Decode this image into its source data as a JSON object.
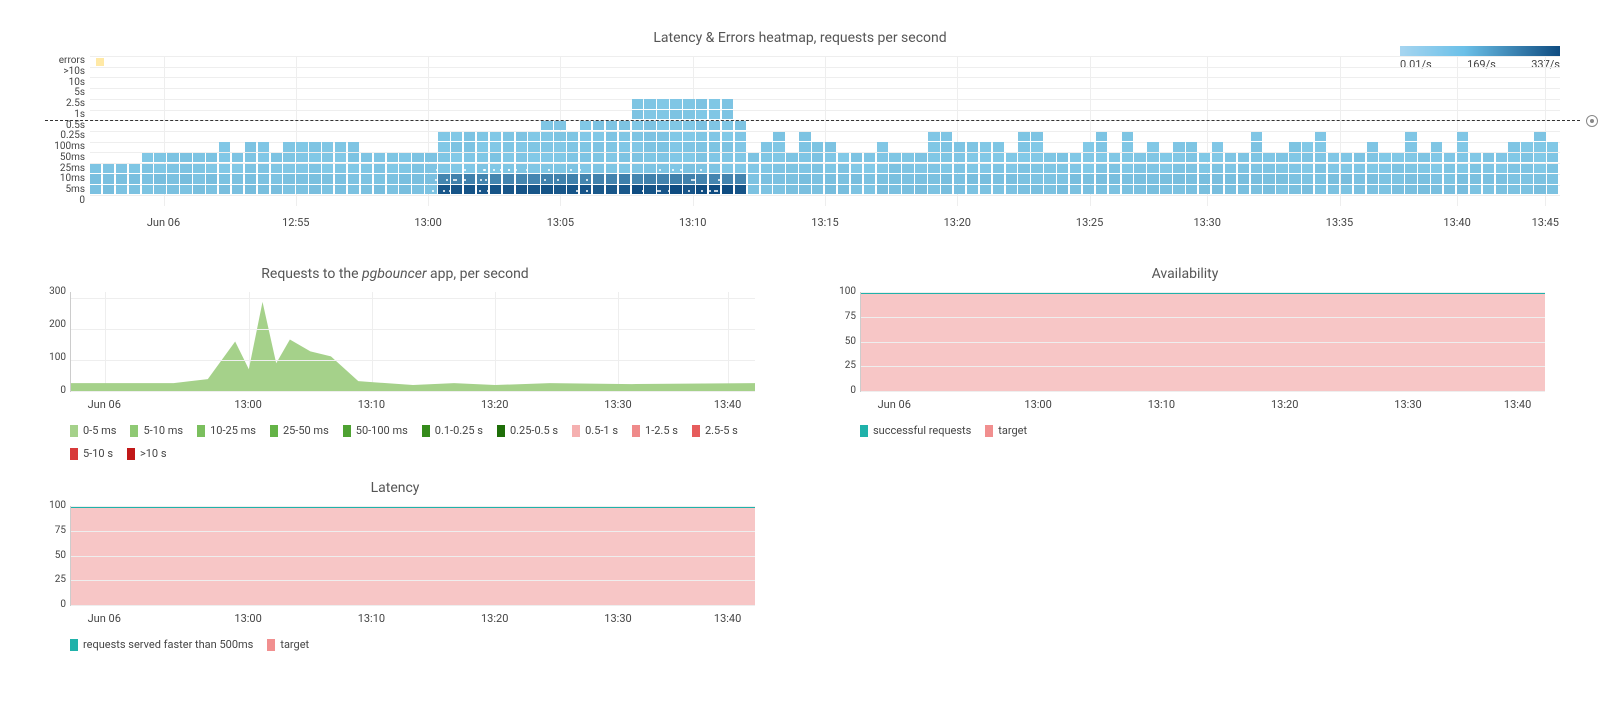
{
  "chart_data": [
    {
      "id": "heatmap",
      "type": "heatmap",
      "title": "Latency & Errors heatmap, requests per second",
      "y_bins": [
        "errors",
        ">10s",
        "10s",
        "5s",
        "2.5s",
        "1s",
        "0.5s",
        "0.25s",
        "100ms",
        "50ms",
        "25ms",
        "10ms",
        "5ms",
        "0"
      ],
      "x_ticks": [
        "Jun 06",
        "12:55",
        "13:00",
        "13:05",
        "13:10",
        "13:15",
        "13:20",
        "13:25",
        "13:30",
        "13:35",
        "13:40",
        "13:45"
      ],
      "x_tick_positions_pct": [
        5,
        14,
        23,
        32,
        41,
        50,
        59,
        68,
        76,
        85,
        93,
        99
      ],
      "color_scale": {
        "min": "0.01/s",
        "mid": "169/s",
        "max": "337/s",
        "colors": [
          "#a6d5f0",
          "#6bc0e8",
          "#0f4c81"
        ]
      },
      "threshold_label": "0.5s",
      "threshold_row_index": 6,
      "dense_dark_region_x_range_pct": [
        23,
        44
      ],
      "max_burst_region_x_range_pct": [
        36,
        43
      ],
      "max_burst_top_row_index": 4,
      "n_x_cells": 114
    },
    {
      "id": "requests",
      "type": "area",
      "title_prefix": "Requests to the ",
      "title_em": "pgbouncer",
      "title_suffix": " app, per second",
      "ylabel": "",
      "xlabel": "",
      "ylim": [
        0,
        320
      ],
      "y_ticks": [
        0,
        100,
        200,
        300
      ],
      "x_ticks": [
        "Jun 06",
        "13:00",
        "13:10",
        "13:20",
        "13:30",
        "13:40"
      ],
      "x_tick_positions_pct": [
        5,
        26,
        44,
        62,
        80,
        96
      ],
      "series": [
        {
          "name": "0-5 ms",
          "color": "#a5d18a"
        },
        {
          "name": "5-10 ms",
          "color": "#8fc974"
        },
        {
          "name": "10-25 ms",
          "color": "#7bbf5e"
        },
        {
          "name": "25-50 ms",
          "color": "#64b347"
        },
        {
          "name": "50-100 ms",
          "color": "#4ea232"
        },
        {
          "name": "0.1-0.25 s",
          "color": "#358b1b"
        },
        {
          "name": "0.25-0.5 s",
          "color": "#1e6e08"
        },
        {
          "name": "0.5-1 s",
          "color": "#f5b0b0"
        },
        {
          "name": "1-2.5 s",
          "color": "#ef8a8a"
        },
        {
          "name": "2.5-5 s",
          "color": "#e65c5c"
        },
        {
          "name": "5-10 s",
          "color": "#d83a3a"
        },
        {
          "name": ">10 s",
          "color": "#c11818"
        }
      ],
      "curve_points_pct": [
        [
          0,
          92
        ],
        [
          15,
          92
        ],
        [
          20,
          88
        ],
        [
          24,
          50
        ],
        [
          26,
          78
        ],
        [
          28,
          10
        ],
        [
          30,
          72
        ],
        [
          32,
          48
        ],
        [
          35,
          60
        ],
        [
          38,
          65
        ],
        [
          42,
          90
        ],
        [
          50,
          94
        ],
        [
          56,
          92
        ],
        [
          62,
          94
        ],
        [
          70,
          92
        ],
        [
          82,
          93
        ],
        [
          100,
          92
        ]
      ]
    },
    {
      "id": "availability",
      "type": "area",
      "title": "Availability",
      "ylim": [
        0,
        100
      ],
      "y_ticks": [
        0,
        25,
        50,
        75,
        100
      ],
      "x_ticks": [
        "Jun 06",
        "13:00",
        "13:10",
        "13:20",
        "13:30",
        "13:40"
      ],
      "x_tick_positions_pct": [
        5,
        26,
        44,
        62,
        80,
        96
      ],
      "series": [
        {
          "name": "successful requests",
          "color": "#20b2aa"
        },
        {
          "name": "target",
          "color": "#f18f8f"
        }
      ],
      "target_value": 100,
      "successful_value": 100
    },
    {
      "id": "latency",
      "type": "area",
      "title": "Latency",
      "ylim": [
        0,
        100
      ],
      "y_ticks": [
        0,
        25,
        50,
        75,
        100
      ],
      "x_ticks": [
        "Jun 06",
        "13:00",
        "13:10",
        "13:20",
        "13:30",
        "13:40"
      ],
      "x_tick_positions_pct": [
        5,
        26,
        44,
        62,
        80,
        96
      ],
      "series": [
        {
          "name": "requests served faster than 500ms",
          "color": "#20b2aa"
        },
        {
          "name": "target",
          "color": "#f18f8f"
        }
      ],
      "target_value": 100,
      "fast_value": 100
    }
  ]
}
